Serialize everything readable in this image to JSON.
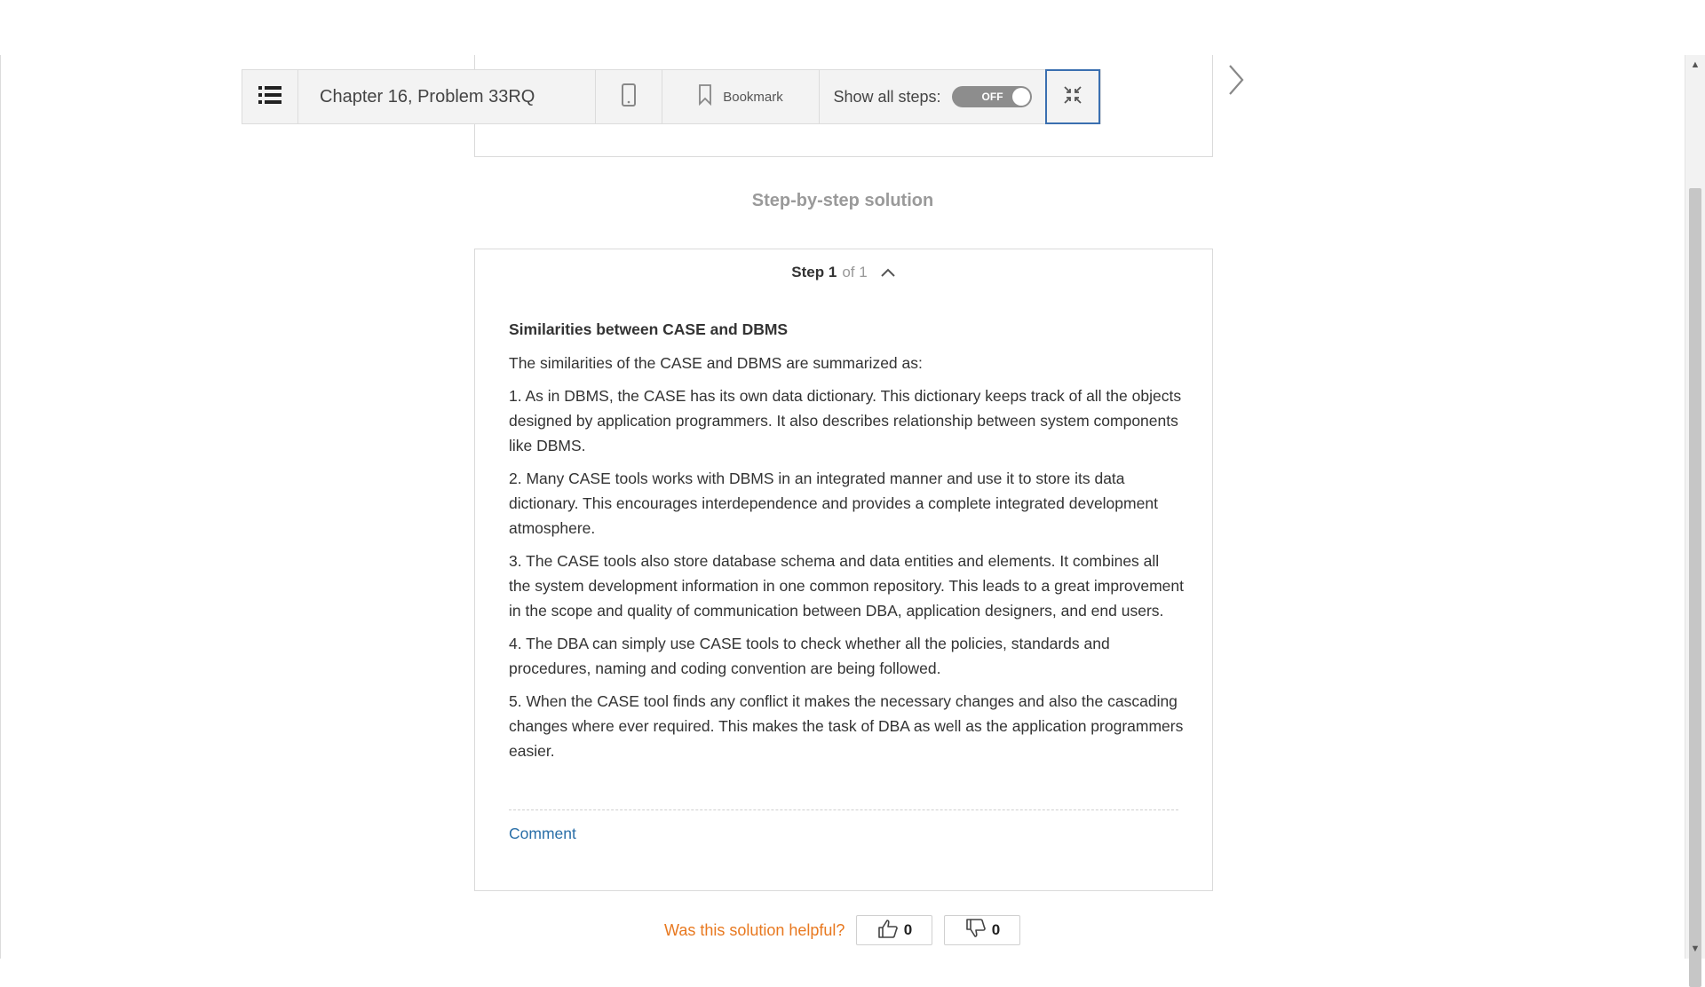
{
  "toolbar": {
    "title": "Chapter 16, Problem 33RQ",
    "bookmark_label": "Bookmark",
    "show_steps_label": "Show all steps:",
    "toggle_state": "OFF"
  },
  "solution": {
    "heading": "Step-by-step solution",
    "step_label": "Step 1",
    "step_of": "of 1",
    "subtitle": "Similarities between CASE and DBMS",
    "intro": "The similarities of the CASE and DBMS are summarized as:",
    "points": [
      "1. As in DBMS, the CASE has its own data dictionary. This dictionary keeps track of all the objects designed by application programmers. It also describes relationship between system components like DBMS.",
      "2. Many CASE tools works with DBMS in an integrated manner and use it to store its data dictionary. This encourages interdependence and provides a complete integrated development atmosphere.",
      "3. The CASE tools also store database schema and data entities and elements. It combines all the system development information in one common repository. This leads to a great improvement in the scope and quality of communication between DBA, application designers, and end users.",
      "4. The DBA can simply use CASE tools to check whether all the policies, standards and procedures, naming and coding convention are being followed.",
      "5. When the CASE tool finds any conflict it makes the necessary changes and also the cascading changes where ever required. This makes the task of DBA as well as the application programmers easier."
    ],
    "comment_label": "Comment"
  },
  "feedback": {
    "question": "Was this solution helpful?",
    "upvotes": "0",
    "downvotes": "0"
  },
  "icons": {
    "menu": "list-icon",
    "mobile": "mobile-phone-icon",
    "bookmark": "bookmark-icon",
    "collapse": "collapse-arrows-icon",
    "next": "chevron-right-icon",
    "step_toggle": "chevron-up-icon",
    "thumbs_up": "thumbs-up-icon",
    "thumbs_down": "thumbs-down-icon"
  },
  "colors": {
    "accent_link": "#2a6fa8",
    "helpful_text": "#e8781f",
    "focus_border": "#3a6fb0"
  }
}
